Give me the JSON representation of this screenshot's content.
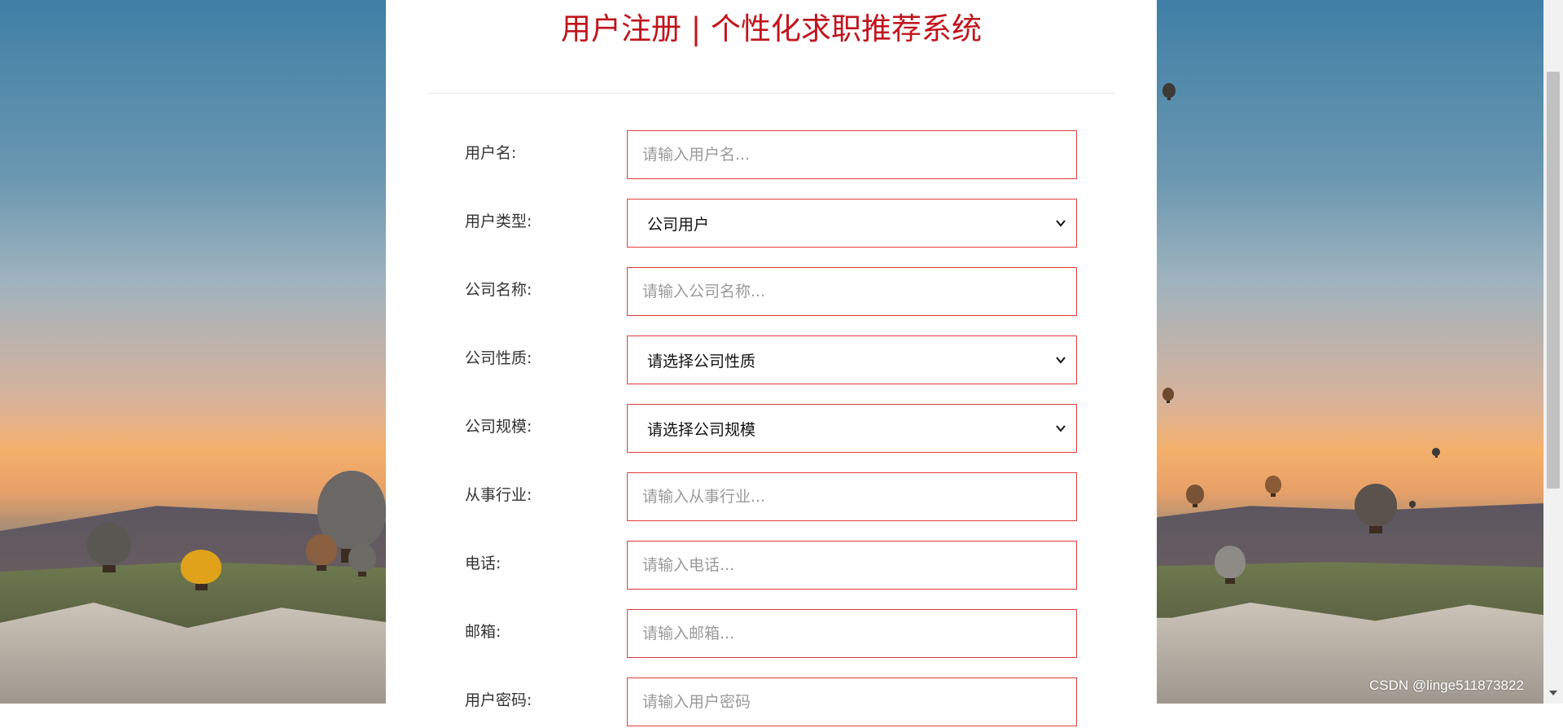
{
  "header": {
    "title": "用户注册 | 个性化求职推荐系统"
  },
  "form": {
    "username": {
      "label": "用户名:",
      "placeholder": "请输入用户名..."
    },
    "user_type": {
      "label": "用户类型:",
      "value": "公司用户"
    },
    "company_name": {
      "label": "公司名称:",
      "placeholder": "请输入公司名称..."
    },
    "company_nature": {
      "label": "公司性质:",
      "value": "请选择公司性质"
    },
    "company_scale": {
      "label": "公司规模:",
      "value": "请选择公司规模"
    },
    "industry": {
      "label": "从事行业:",
      "placeholder": "请输入从事行业..."
    },
    "phone": {
      "label": "电话:",
      "placeholder": "请输入电话..."
    },
    "email": {
      "label": "邮箱:",
      "placeholder": "请输入邮箱..."
    },
    "password": {
      "label": "用户密码:",
      "placeholder": "请输入用户密码"
    }
  },
  "watermark": "CSDN @linge511873822",
  "colors": {
    "accent": "#c0141c",
    "field_border": "#e23b3b"
  },
  "icons": {
    "select_arrow": "chevron-down-icon",
    "scroll_down": "scroll-down-arrow-icon"
  }
}
